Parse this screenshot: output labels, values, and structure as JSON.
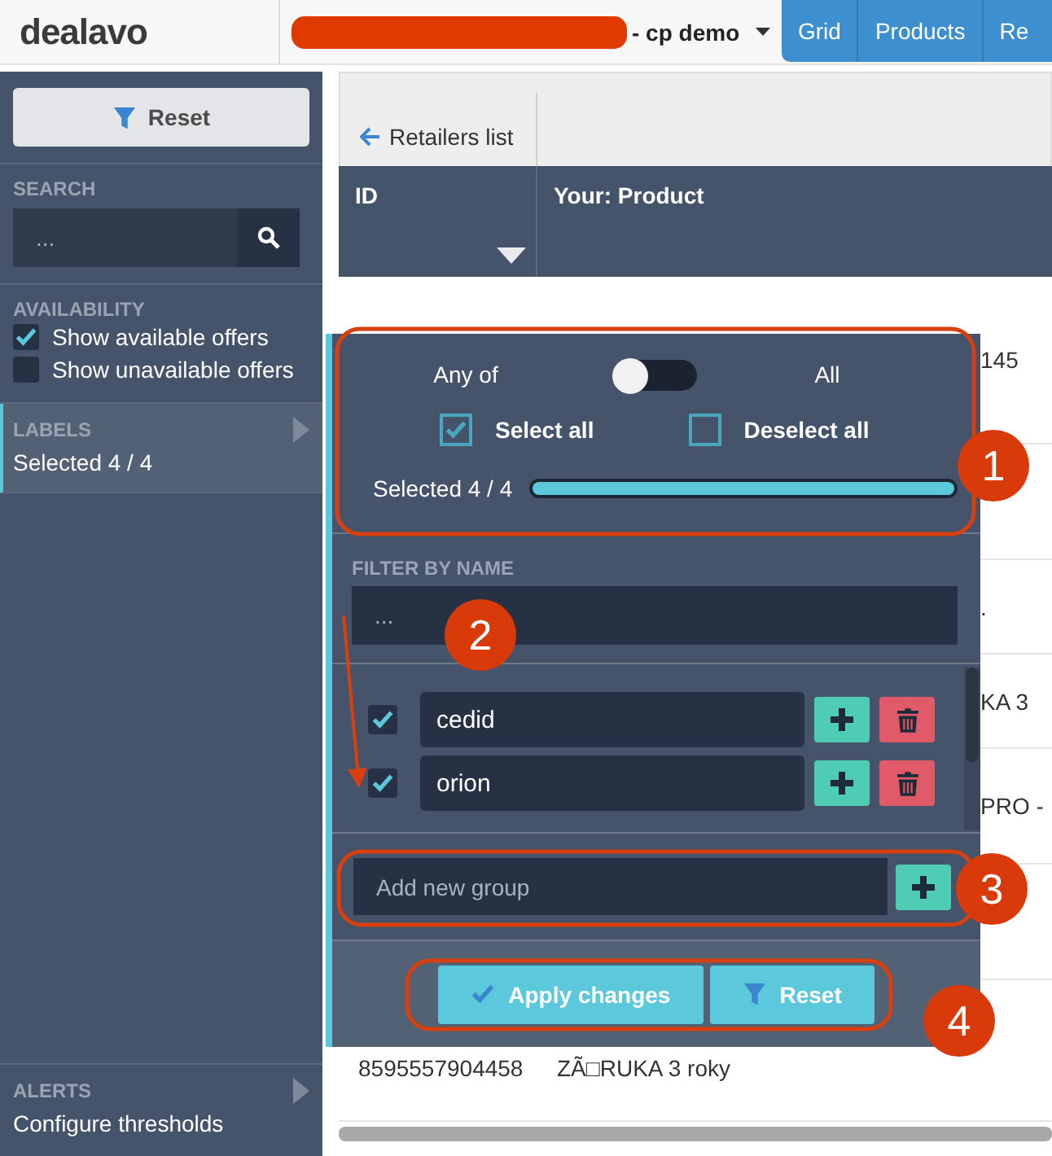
{
  "header": {
    "logo": "dealavo",
    "account": "- cp demo",
    "nav_tabs": [
      "Grid",
      "Products",
      "Re"
    ]
  },
  "sidebar": {
    "reset_button": "Reset",
    "search": {
      "label": "SEARCH",
      "placeholder": "..."
    },
    "availability": {
      "label": "AVAILABILITY",
      "options": [
        {
          "label": "Show available offers",
          "checked": true
        },
        {
          "label": "Show unavailable offers",
          "checked": false
        }
      ]
    },
    "labels_section": {
      "label": "LABELS",
      "value": "Selected 4 / 4",
      "selected": true
    },
    "alerts_section": {
      "label": "ALERTS",
      "value": "Configure thresholds",
      "selected": false
    }
  },
  "toolbar": {
    "back_link": "Retailers list"
  },
  "table": {
    "columns": [
      "ID",
      "Your: Product"
    ],
    "rows": [
      {
        "product": "145"
      },
      {},
      {
        "product": "."
      },
      {
        "product": "KA 3"
      },
      {
        "product": "PRO -"
      },
      {},
      {
        "id": "8595557904458",
        "product": "ZÃ□RUKA 3 roky"
      }
    ]
  },
  "labels_popup": {
    "match_mode": {
      "left": "Any of",
      "right": "All",
      "on": false
    },
    "select_all": {
      "label": "Select all",
      "checked": true
    },
    "deselect_all": {
      "label": "Deselect all",
      "checked": false
    },
    "selected_text": "Selected 4 / 4",
    "level": 1,
    "filter": {
      "label": "FILTER BY NAME",
      "placeholder": "..."
    },
    "groups": [
      {
        "name": "cedid",
        "checked": true
      },
      {
        "name": "orion",
        "checked": true
      }
    ],
    "new_group": {
      "placeholder": "Add new group"
    },
    "buttons": [
      {
        "label": "Apply changes",
        "kind": "apply"
      },
      {
        "label": "Reset",
        "kind": "reset"
      }
    ]
  },
  "annotations": [
    {
      "label": "1"
    },
    {
      "label": "2"
    },
    {
      "label": "3"
    },
    {
      "label": "4"
    }
  ]
}
